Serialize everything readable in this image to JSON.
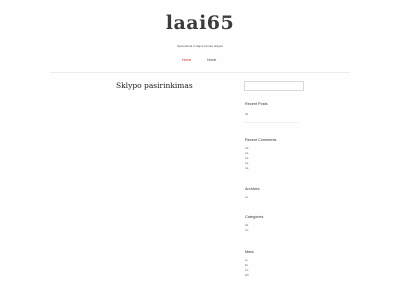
{
  "site": {
    "title": "laai65",
    "description": "Sprendimai ir idėjos žemės sklypui"
  },
  "nav": {
    "items": [
      {
        "label": "Home",
        "active": true
      },
      {
        "label": "Home",
        "active": false
      }
    ]
  },
  "main": {
    "post_title": "Sklypo pasirinkimas"
  },
  "sidebar": {
    "search_placeholder": "",
    "recent_posts": {
      "title": "Recent Posts",
      "items": [
        "Sk"
      ]
    },
    "recent_comments": {
      "title": "Recent Comments",
      "items": [
        "Ca",
        "Ca",
        "Ca",
        "Ca",
        "Ca"
      ]
    },
    "archives": {
      "title": "Archives",
      "items": [
        "Ja"
      ]
    },
    "categories": {
      "title": "Categories",
      "items": [
        "Ab",
        "Un"
      ]
    },
    "meta": {
      "title": "Meta",
      "items": [
        "Lo",
        "En",
        "Co",
        "Wo"
      ]
    }
  },
  "colors": {
    "accent": "#c0392b",
    "text": "#333333"
  }
}
